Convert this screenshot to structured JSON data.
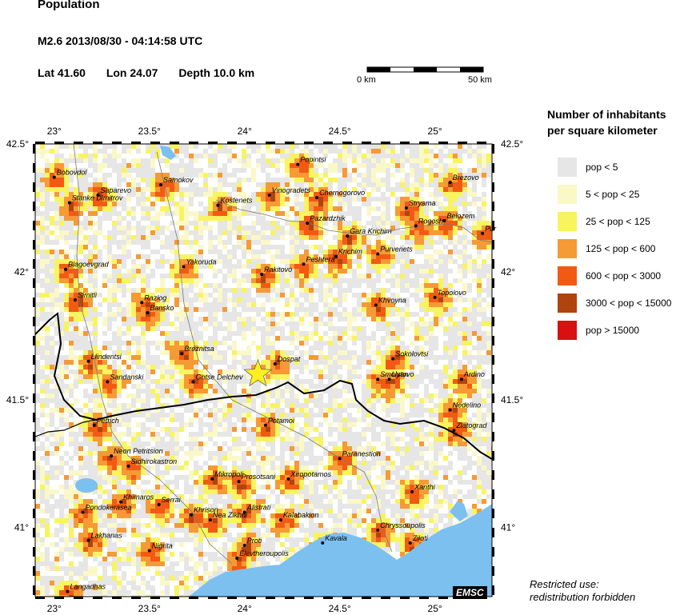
{
  "header": {
    "title": "Population",
    "event": "M2.6  2013/08/30 - 04:14:58 UTC",
    "lat": "Lat 41.60",
    "lon": "Lon 24.07",
    "depth": "Depth  10.0 km"
  },
  "scale_bar": {
    "start_label": "0 km",
    "end_label": "50 km"
  },
  "map": {
    "lon_range": [
      22.9,
      25.3
    ],
    "lat_range": [
      40.73,
      42.5
    ],
    "lon_ticks": [
      23.0,
      23.5,
      24.0,
      24.5,
      25.0
    ],
    "lon_tick_labels": [
      "23°",
      "23.5°",
      "24°",
      "24.5°",
      "25°"
    ],
    "lat_ticks": [
      41.0,
      41.5,
      42.0,
      42.5
    ],
    "lat_tick_labels": [
      "41°",
      "41.5°",
      "42°",
      "42.5°"
    ],
    "epicenter": {
      "lon": 24.07,
      "lat": 41.6,
      "color": "#ffee22"
    },
    "sea_color": "#7cc0f0",
    "places": [
      {
        "name": "Bobovdol",
        "lon": 23.0,
        "lat": 42.37
      },
      {
        "name": "Samokov",
        "lon": 23.56,
        "lat": 42.34
      },
      {
        "name": "Popintsi",
        "lon": 24.28,
        "lat": 42.42
      },
      {
        "name": "Brezovo",
        "lon": 25.08,
        "lat": 42.35
      },
      {
        "name": "Saparevo",
        "lon": 23.23,
        "lat": 42.3
      },
      {
        "name": "Stanke Dimitrov",
        "lon": 23.08,
        "lat": 42.27
      },
      {
        "name": "Kostenets",
        "lon": 23.86,
        "lat": 42.26
      },
      {
        "name": "Vinogradets",
        "lon": 24.13,
        "lat": 42.3
      },
      {
        "name": "Chernogorovo",
        "lon": 24.38,
        "lat": 42.29
      },
      {
        "name": "Stryama",
        "lon": 24.85,
        "lat": 42.25
      },
      {
        "name": "Rogosh",
        "lon": 24.9,
        "lat": 42.18
      },
      {
        "name": "Belozem",
        "lon": 25.05,
        "lat": 42.2
      },
      {
        "name": "Pazardzhik",
        "lon": 24.33,
        "lat": 42.19
      },
      {
        "name": "Gara Krichim",
        "lon": 24.54,
        "lat": 42.14
      },
      {
        "name": "Purvenets",
        "lon": 24.7,
        "lat": 42.07
      },
      {
        "name": "Pur",
        "lon": 25.25,
        "lat": 42.15
      },
      {
        "name": "Krichim",
        "lon": 24.48,
        "lat": 42.06
      },
      {
        "name": "Peshtera",
        "lon": 24.31,
        "lat": 42.03
      },
      {
        "name": "Blagoevgrad",
        "lon": 23.06,
        "lat": 42.01
      },
      {
        "name": "Yakoruda",
        "lon": 23.68,
        "lat": 42.02
      },
      {
        "name": "Rakitovo",
        "lon": 24.09,
        "lat": 41.99
      },
      {
        "name": "Topolovo",
        "lon": 25.0,
        "lat": 41.9
      },
      {
        "name": "Simitli",
        "lon": 23.11,
        "lat": 41.89
      },
      {
        "name": "Razlog",
        "lon": 23.46,
        "lat": 41.88
      },
      {
        "name": "Bansko",
        "lon": 23.49,
        "lat": 41.84
      },
      {
        "name": "Khvoyna",
        "lon": 24.69,
        "lat": 41.87
      },
      {
        "name": "Breznitsa",
        "lon": 23.67,
        "lat": 41.68
      },
      {
        "name": "Llindentsi",
        "lon": 23.18,
        "lat": 41.65
      },
      {
        "name": "Dospat",
        "lon": 24.16,
        "lat": 41.64
      },
      {
        "name": "Sokolovtsi",
        "lon": 24.78,
        "lat": 41.66
      },
      {
        "name": "Sandanski",
        "lon": 23.28,
        "lat": 41.57
      },
      {
        "name": "Gotse Delchev",
        "lon": 23.73,
        "lat": 41.57
      },
      {
        "name": "Smolyan",
        "lon": 24.7,
        "lat": 41.58
      },
      {
        "name": "Ustovo",
        "lon": 24.76,
        "lat": 41.58
      },
      {
        "name": "Ardino",
        "lon": 25.14,
        "lat": 41.58
      },
      {
        "name": "Nedelino",
        "lon": 25.08,
        "lat": 41.46
      },
      {
        "name": "Zlatograd",
        "lon": 25.1,
        "lat": 41.38
      },
      {
        "name": "Petrich",
        "lon": 23.21,
        "lat": 41.4
      },
      {
        "name": "Potamoi",
        "lon": 24.11,
        "lat": 41.4
      },
      {
        "name": "Neon Petritsion",
        "lon": 23.3,
        "lat": 41.28
      },
      {
        "name": "Paranestion",
        "lon": 24.5,
        "lat": 41.27
      },
      {
        "name": "Sidhirokastron",
        "lon": 23.39,
        "lat": 41.24
      },
      {
        "name": "Mikropoli",
        "lon": 23.83,
        "lat": 41.19
      },
      {
        "name": "Prosotsani",
        "lon": 23.97,
        "lat": 41.18
      },
      {
        "name": "Xiropotamos",
        "lon": 24.23,
        "lat": 41.19
      },
      {
        "name": "Xanthi",
        "lon": 24.88,
        "lat": 41.14
      },
      {
        "name": "Khimaros",
        "lon": 23.35,
        "lat": 41.1
      },
      {
        "name": "Pondokerasea",
        "lon": 23.15,
        "lat": 41.06
      },
      {
        "name": "Serrai",
        "lon": 23.55,
        "lat": 41.09
      },
      {
        "name": "Alistrati",
        "lon": 24.0,
        "lat": 41.06
      },
      {
        "name": "Khrison",
        "lon": 23.72,
        "lat": 41.05
      },
      {
        "name": "Nea Zikhni",
        "lon": 23.82,
        "lat": 41.03
      },
      {
        "name": "Kalabakion",
        "lon": 24.19,
        "lat": 41.03
      },
      {
        "name": "Chryssoupolis",
        "lon": 24.7,
        "lat": 40.99
      },
      {
        "name": "Ziloti",
        "lon": 24.87,
        "lat": 40.94
      },
      {
        "name": "Lakhanas",
        "lon": 23.18,
        "lat": 40.95
      },
      {
        "name": "Proti",
        "lon": 24.0,
        "lat": 40.93
      },
      {
        "name": "Kavala",
        "lon": 24.41,
        "lat": 40.94
      },
      {
        "name": "Nigrita",
        "lon": 23.5,
        "lat": 40.91
      },
      {
        "name": "Elevtheroupolis",
        "lon": 23.96,
        "lat": 40.88
      },
      {
        "name": "Langadhas",
        "lon": 23.07,
        "lat": 40.75
      }
    ]
  },
  "legend": {
    "title_line1": "Number of inhabitants",
    "title_line2": "per square kilometer",
    "items": [
      {
        "label": "pop < 5",
        "color": "#e6e6e6"
      },
      {
        "label": "5 < pop < 25",
        "color": "#fbf8c8"
      },
      {
        "label": "25 < pop < 125",
        "color": "#f8f460"
      },
      {
        "label": "125 < pop < 600",
        "color": "#f59a35"
      },
      {
        "label": "600 < pop < 3000",
        "color": "#f25a14"
      },
      {
        "label": "3000 < pop < 15000",
        "color": "#b0440e"
      },
      {
        "label": "pop > 15000",
        "color": "#d81010"
      }
    ]
  },
  "footer": {
    "note_line1": "Restricted use:",
    "note_line2": "redistribution forbidden",
    "badge": "EMSC"
  }
}
